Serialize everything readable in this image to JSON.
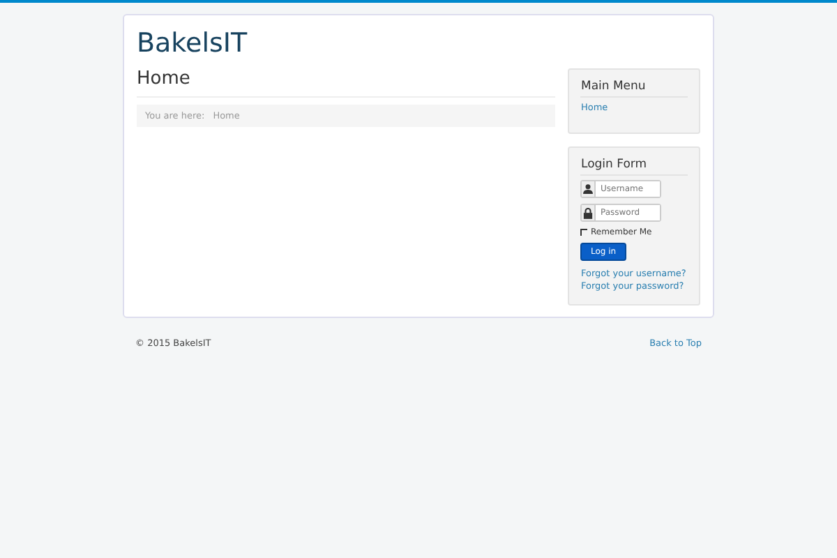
{
  "site_title": "BakelsIT",
  "page_heading": "Home",
  "breadcrumb": {
    "label": "You are here:",
    "items": [
      "Home"
    ]
  },
  "main_menu": {
    "title": "Main Menu",
    "items": [
      {
        "label": "Home",
        "selected": false
      }
    ]
  },
  "login_form": {
    "title": "Login Form",
    "username": {
      "placeholder": "Username"
    },
    "password": {
      "placeholder": "Password"
    },
    "remember": {
      "label": "Remember Me",
      "checked": false
    },
    "button": "Log in",
    "links": [
      "Forgot your username?",
      "Forgot your password?"
    ]
  },
  "footer": {
    "copyright": "© 2015 BakelsIT",
    "back_to_top": "Back to Top"
  }
}
